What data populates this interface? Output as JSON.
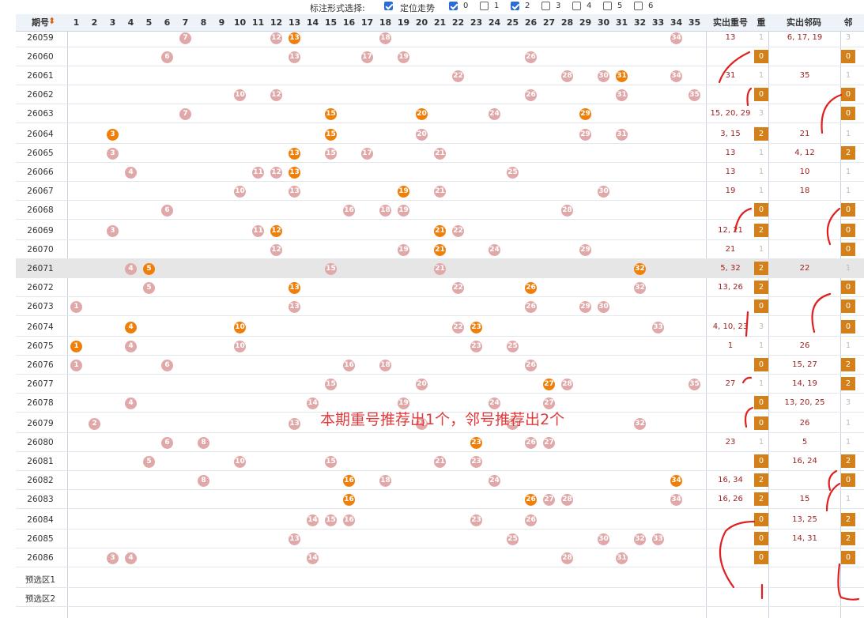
{
  "options": {
    "label": "标注形式选择:",
    "trend_label": "定位走势",
    "trend_checked": true,
    "nums": [
      {
        "v": "0",
        "on": true
      },
      {
        "v": "1",
        "on": false
      },
      {
        "v": "2",
        "on": true
      },
      {
        "v": "3",
        "on": false
      },
      {
        "v": "4",
        "on": false
      },
      {
        "v": "5",
        "on": false
      },
      {
        "v": "6",
        "on": false
      }
    ]
  },
  "header": {
    "period": "期号",
    "repeat": "实出重号",
    "r": "重",
    "neighbor": "实出邻码",
    "n": "邻"
  },
  "rows": [
    {
      "p": "26059",
      "pink": [
        7,
        12,
        18,
        34
      ],
      "orange": [
        13
      ],
      "rep": "13",
      "rc": "1",
      "nb": "6, 17, 19",
      "nc": "3"
    },
    {
      "p": "26060",
      "pink": [
        6,
        13,
        17,
        19,
        26
      ],
      "orange": [],
      "rep": "",
      "rc": "0",
      "nb": "",
      "nc": "0"
    },
    {
      "p": "26061",
      "pink": [
        22,
        28,
        30,
        34
      ],
      "orange": [
        31
      ],
      "rep": "31",
      "rc": "1",
      "nb": "35",
      "nc": "1"
    },
    {
      "p": "26062",
      "pink": [
        10,
        12,
        26,
        31,
        35
      ],
      "orange": [],
      "rep": "",
      "rc": "0",
      "nb": "",
      "nc": "0"
    },
    {
      "p": "26063",
      "pink": [
        7,
        24
      ],
      "orange": [
        15,
        20,
        29
      ],
      "rep": "15, 20, 29",
      "rc": "3",
      "nb": "",
      "nc": "0"
    },
    {
      "p": "26064",
      "pink": [
        20,
        29,
        31
      ],
      "orange": [
        3,
        15
      ],
      "rep": "3, 15",
      "rc": "2",
      "nb": "21",
      "nc": "1"
    },
    {
      "p": "26065",
      "pink": [
        3,
        15,
        17,
        21
      ],
      "orange": [
        13
      ],
      "rep": "13",
      "rc": "1",
      "nb": "4, 12",
      "nc": "2"
    },
    {
      "p": "26066",
      "pink": [
        4,
        11,
        12,
        25
      ],
      "orange": [
        13
      ],
      "rep": "13",
      "rc": "1",
      "nb": "10",
      "nc": "1"
    },
    {
      "p": "26067",
      "pink": [
        10,
        13,
        21,
        30
      ],
      "orange": [
        19
      ],
      "rep": "19",
      "rc": "1",
      "nb": "18",
      "nc": "1"
    },
    {
      "p": "26068",
      "pink": [
        6,
        16,
        18,
        19,
        28
      ],
      "orange": [],
      "rep": "",
      "rc": "0",
      "nb": "",
      "nc": "0"
    },
    {
      "p": "26069",
      "pink": [
        3,
        11,
        22
      ],
      "orange": [
        12,
        21
      ],
      "rep": "12, 21",
      "rc": "2",
      "nb": "",
      "nc": "0"
    },
    {
      "p": "26070",
      "pink": [
        12,
        19,
        24,
        29
      ],
      "orange": [
        21
      ],
      "rep": "21",
      "rc": "1",
      "nb": "",
      "nc": "0"
    },
    {
      "p": "26071",
      "pink": [
        4,
        15,
        21
      ],
      "orange": [
        5,
        32
      ],
      "rep": "5, 32",
      "rc": "2",
      "nb": "22",
      "nc": "1"
    },
    {
      "p": "26072",
      "pink": [
        5,
        22,
        32
      ],
      "orange": [
        13,
        26
      ],
      "rep": "13, 26",
      "rc": "2",
      "nb": "",
      "nc": "0"
    },
    {
      "p": "26073",
      "pink": [
        1,
        13,
        26,
        29,
        30
      ],
      "orange": [],
      "rep": "",
      "rc": "0",
      "nb": "",
      "nc": "0"
    },
    {
      "p": "26074",
      "pink": [
        22,
        33
      ],
      "orange": [
        4,
        10,
        23
      ],
      "rep": "4, 10, 23",
      "rc": "3",
      "nb": "",
      "nc": "0"
    },
    {
      "p": "26075",
      "pink": [
        4,
        10,
        23,
        25
      ],
      "orange": [
        1
      ],
      "rep": "1",
      "rc": "1",
      "nb": "26",
      "nc": "1"
    },
    {
      "p": "26076",
      "pink": [
        1,
        6,
        16,
        18,
        26
      ],
      "orange": [],
      "rep": "",
      "rc": "0",
      "nb": "15, 27",
      "nc": "2"
    },
    {
      "p": "26077",
      "pink": [
        15,
        20,
        28,
        35
      ],
      "orange": [
        27
      ],
      "rep": "27",
      "rc": "1",
      "nb": "14, 19",
      "nc": "2"
    },
    {
      "p": "26078",
      "pink": [
        4,
        14,
        19,
        24,
        27
      ],
      "orange": [],
      "rep": "",
      "rc": "0",
      "nb": "13, 20, 25",
      "nc": "3"
    },
    {
      "p": "26079",
      "pink": [
        2,
        13,
        20,
        25,
        32
      ],
      "orange": [],
      "rep": "",
      "rc": "0",
      "nb": "26",
      "nc": "1"
    },
    {
      "p": "26080",
      "pink": [
        6,
        8,
        26,
        27
      ],
      "orange": [
        23
      ],
      "rep": "23",
      "rc": "1",
      "nb": "5",
      "nc": "1"
    },
    {
      "p": "26081",
      "pink": [
        5,
        10,
        15,
        21,
        23
      ],
      "orange": [],
      "rep": "",
      "rc": "0",
      "nb": "16, 24",
      "nc": "2"
    },
    {
      "p": "26082",
      "pink": [
        8,
        18,
        24
      ],
      "orange": [
        16,
        34
      ],
      "rep": "16, 34",
      "rc": "2",
      "nb": "",
      "nc": "0"
    },
    {
      "p": "26083",
      "pink": [
        27,
        28,
        34
      ],
      "orange": [
        16,
        26
      ],
      "rep": "16, 26",
      "rc": "2",
      "nb": "15",
      "nc": "1"
    },
    {
      "p": "26084",
      "pink": [
        14,
        15,
        16,
        23,
        26
      ],
      "orange": [],
      "rep": "",
      "rc": "0",
      "nb": "13, 25",
      "nc": "2"
    },
    {
      "p": "26085",
      "pink": [
        13,
        25,
        30,
        32,
        33
      ],
      "orange": [],
      "rep": "",
      "rc": "0",
      "nb": "14, 31",
      "nc": "2"
    },
    {
      "p": "26086",
      "pink": [
        3,
        4,
        14,
        28,
        31
      ],
      "orange": [],
      "rep": "",
      "rc": "0",
      "nb": "",
      "nc": "0"
    }
  ],
  "presel": [
    "预选区1",
    "预选区2"
  ],
  "annotation": "本期重号推荐出1个，邻号推荐出2个",
  "colors": {
    "orange": "#f07f09",
    "pink": "#e0a8a8",
    "box": "#d4801a",
    "red": "#e23a3a"
  }
}
